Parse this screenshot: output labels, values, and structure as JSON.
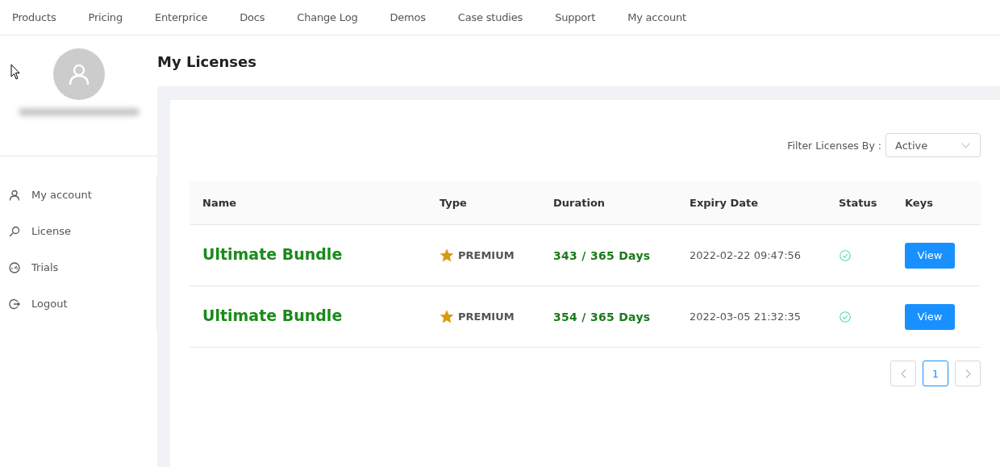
{
  "nav": {
    "items": [
      "Products",
      "Pricing",
      "Enterprice",
      "Docs",
      "Change Log",
      "Demos",
      "Case studies",
      "Support",
      "My account"
    ]
  },
  "sidebar": {
    "items": [
      {
        "label": "My account"
      },
      {
        "label": "License"
      },
      {
        "label": "Trials"
      },
      {
        "label": "Logout"
      }
    ]
  },
  "page": {
    "title": "My Licenses"
  },
  "filter": {
    "label": "Filter Licenses By :",
    "value": "Active"
  },
  "table": {
    "columns": [
      "Name",
      "Type",
      "Duration",
      "Expiry Date",
      "Status",
      "Keys"
    ],
    "rows": [
      {
        "name": "Ultimate Bundle",
        "type": "PREMIUM",
        "duration": "343 / 365 Days",
        "expiry": "2022-02-22 09:47:56",
        "active": true,
        "action": "View"
      },
      {
        "name": "Ultimate Bundle",
        "type": "PREMIUM",
        "duration": "354 / 365 Days",
        "expiry": "2022-03-05 21:32:35",
        "active": true,
        "action": "View"
      }
    ]
  },
  "pagination": {
    "pages": [
      {
        "label": "1",
        "selected": true
      }
    ]
  }
}
